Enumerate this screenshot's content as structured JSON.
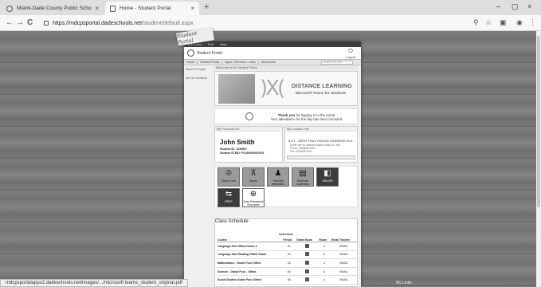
{
  "browser": {
    "tabs": [
      {
        "title": "Miami-Dade County Public Scho",
        "active": false
      },
      {
        "title": "Home - Student Portal",
        "active": true
      }
    ],
    "new_tab": "+",
    "controls": {
      "minimize": "–",
      "maximize": "▢",
      "close": "×"
    },
    "nav": {
      "back": "←",
      "forward": "→",
      "reload": "C"
    },
    "url_host": "https://mdcpsportal.dadeschools.net",
    "url_path": "/student/default.aspx",
    "tools": {
      "zoom": "⚲",
      "star": "☆",
      "ext": "▣",
      "profile": "◉",
      "menu": "⋮"
    }
  },
  "portal": {
    "logo_text": "Student Portal",
    "top_strip": [
      "Site Index",
      "Pref",
      "Help"
    ],
    "header_title": "Student Portal",
    "logout": "Logout",
    "menu": [
      "Home",
      "Student Portal",
      "Apps / Services / Links",
      "Directories"
    ],
    "search_placeholder": "Search this site...",
    "sidebar": [
      "Search People",
      "All Kid Contacts"
    ],
    "breadcrumb": "Welcome to the Student Portal",
    "banner": {
      "title": "DISTANCE LEARNING",
      "subtitle": "Microsoft Teams for Students"
    },
    "thanks_bold": "Thank you",
    "thanks_rest": "for logging in to the portal.",
    "thanks_line2": "Your attendance for the day has been recorded.",
    "personal": {
      "header": "My Personal Info",
      "name": "John Smith",
      "student_id": "Student ID: 1234567",
      "flsid": "Student FLEID: FL000000087654"
    },
    "location": {
      "header": "My Location Info",
      "school": "5171 - WEST HOLLYWOOD GARDENS ELE...",
      "address_line1": "Under see for address location data, no. ###",
      "phone": "Phone: (305)555-0000",
      "fax": "Fax: (305)555-0001"
    },
    "tiles": [
      {
        "label": "Report Card",
        "icon": "report-card-icon",
        "glyph": "♔"
      },
      {
        "label": "Scores",
        "icon": "scores-icon",
        "glyph": "⊼"
      },
      {
        "label": "Personal Information",
        "icon": "personal-info-icon",
        "glyph": "♟"
      },
      {
        "label": "Electronic Gradebook",
        "icon": "gradebook-icon",
        "glyph": "▤"
      },
      {
        "label": "Office365",
        "icon": "office365-icon",
        "glyph": "◧"
      },
      {
        "label": "iPREP",
        "icon": "iprep-icon",
        "glyph": "⇆"
      },
      {
        "label": "Open Educational Resources",
        "icon": "oer-icon",
        "glyph": "⊕"
      }
    ],
    "schedule": {
      "header": "Class Schedule",
      "title": "Schedule",
      "columns": [
        "Course",
        "Period",
        "Grade Book",
        "Room",
        "Email Teacher"
      ],
      "rows": [
        {
          "course": "Language Arts Gifted Grade 4",
          "period": "01",
          "room": "4",
          "email": "EMAIL"
        },
        {
          "course": "Language Arts Reading Gifted Grade",
          "period": "02",
          "room": "4",
          "email": "EMAIL"
        },
        {
          "course": "Mathematics - Grade Four Gifted",
          "period": "03",
          "room": "4",
          "email": "EMAIL"
        },
        {
          "course": "Science - Grade Four - Gifted",
          "period": "04",
          "room": "4",
          "email": "EMAIL"
        },
        {
          "course": "Social Studies Grade Four Gifted",
          "period": "05",
          "room": "4",
          "email": "EMAIL"
        }
      ]
    }
  },
  "status_url": "mdcpsportalapps2.dadeschools.net/images/.../microsoft teams_student_original.pdf",
  "footer_text": "My Links"
}
